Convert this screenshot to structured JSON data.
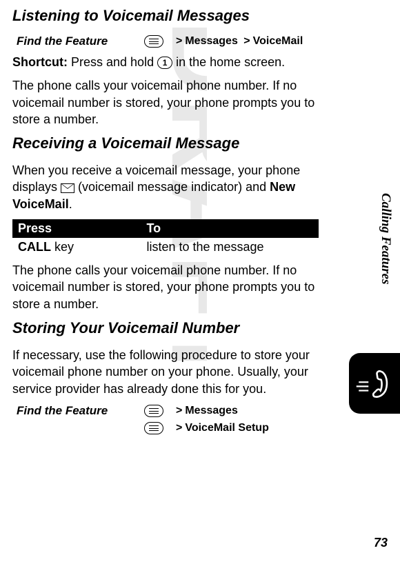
{
  "watermark": "DRAFT",
  "side_tab": "Calling Features",
  "page_number": "73",
  "sections": {
    "listening": {
      "title": "Listening to Voicemail Messages",
      "find_feature_label": "Find the Feature",
      "nav_sep": ">",
      "nav_item1": "Messages",
      "nav_item2": "VoiceMail",
      "shortcut_label": "Shortcut:",
      "shortcut_text_before": " Press and hold ",
      "key1_label": "1",
      "shortcut_text_after": " in the home screen.",
      "body1": "The phone calls your voicemail phone number. If no voicemail number is stored, your phone prompts you to store a number."
    },
    "receiving": {
      "title": "Receiving a Voicemail Message",
      "body_before_icon": "When you receive a voicemail message, your phone displays ",
      "body_mid": " (voicemail message indicator) and ",
      "new_voicemail": "New VoiceMail",
      "body_after": ".",
      "table": {
        "header_press": "Press",
        "header_to": "To",
        "cell_press_cond": "CALL",
        "cell_press_rest": " key",
        "cell_to": "listen to the message"
      },
      "body2": "The phone calls your voicemail phone number. If no voicemail number is stored, your phone prompts you to store a number."
    },
    "storing": {
      "title": "Storing Your Voicemail Number",
      "body1": "If necessary, use the following procedure to store your voicemail phone number on your phone. Usually, your service provider has already done this for you.",
      "find_feature_label": "Find the Feature",
      "nav_sep": ">",
      "nav_line1": "Messages",
      "nav_line2": "VoiceMail Setup"
    }
  }
}
